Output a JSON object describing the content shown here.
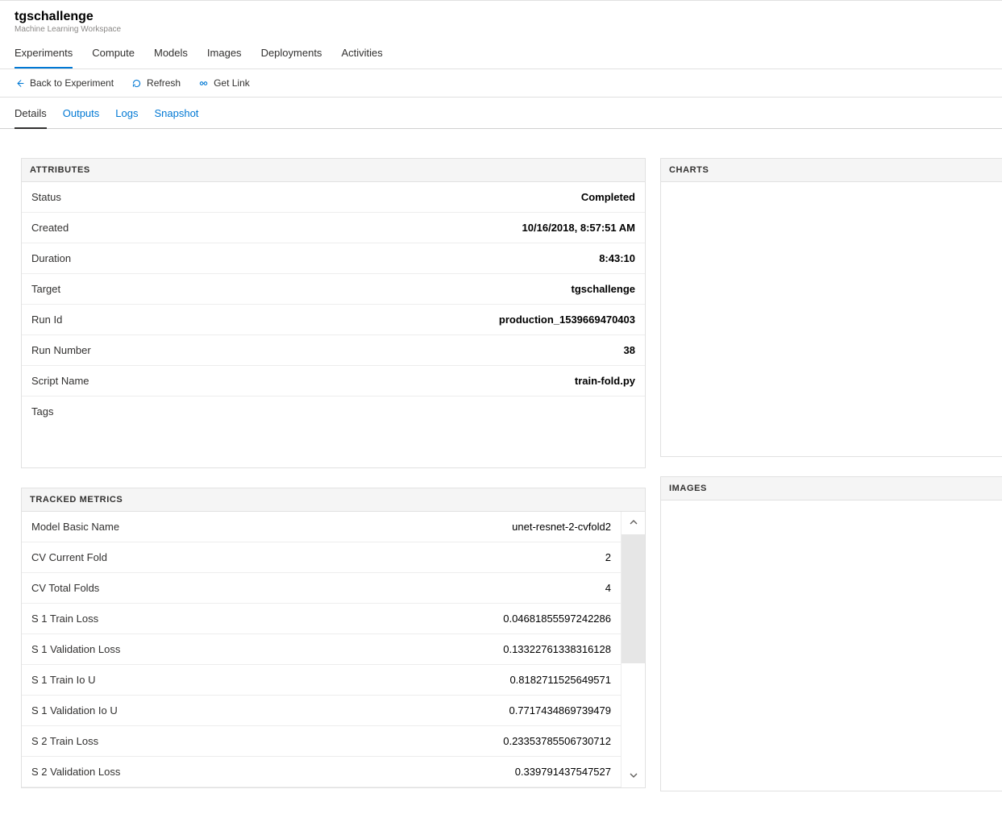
{
  "header": {
    "title": "tgschallenge",
    "subtitle": "Machine Learning Workspace"
  },
  "topTabs": [
    {
      "label": "Experiments",
      "active": true
    },
    {
      "label": "Compute",
      "active": false
    },
    {
      "label": "Models",
      "active": false
    },
    {
      "label": "Images",
      "active": false
    },
    {
      "label": "Deployments",
      "active": false
    },
    {
      "label": "Activities",
      "active": false
    }
  ],
  "toolbar": {
    "back": "Back to Experiment",
    "refresh": "Refresh",
    "getlink": "Get Link"
  },
  "subTabs": [
    {
      "label": "Details",
      "active": true
    },
    {
      "label": "Outputs",
      "active": false
    },
    {
      "label": "Logs",
      "active": false
    },
    {
      "label": "Snapshot",
      "active": false
    }
  ],
  "panels": {
    "attributes": "ATTRIBUTES",
    "metrics": "TRACKED METRICS",
    "charts": "CHARTS",
    "images": "IMAGES"
  },
  "attributes": [
    {
      "label": "Status",
      "value": "Completed"
    },
    {
      "label": "Created",
      "value": "10/16/2018, 8:57:51 AM"
    },
    {
      "label": "Duration",
      "value": "8:43:10"
    },
    {
      "label": "Target",
      "value": "tgschallenge"
    },
    {
      "label": "Run Id",
      "value": "production_1539669470403"
    },
    {
      "label": "Run Number",
      "value": "38"
    },
    {
      "label": "Script Name",
      "value": "train-fold.py"
    },
    {
      "label": "Tags",
      "value": ""
    }
  ],
  "metrics": [
    {
      "label": "Model Basic Name",
      "value": "unet-resnet-2-cvfold2"
    },
    {
      "label": "CV Current Fold",
      "value": "2"
    },
    {
      "label": "CV Total Folds",
      "value": "4"
    },
    {
      "label": "S 1 Train Loss",
      "value": "0.04681855597242286"
    },
    {
      "label": "S 1 Validation Loss",
      "value": "0.13322761338316128"
    },
    {
      "label": "S 1 Train Io U",
      "value": "0.8182711525649571"
    },
    {
      "label": "S 1 Validation Io U",
      "value": "0.7717434869739479"
    },
    {
      "label": "S 2 Train Loss",
      "value": "0.23353785506730712"
    },
    {
      "label": "S 2 Validation Loss",
      "value": "0.339791437547527"
    }
  ]
}
